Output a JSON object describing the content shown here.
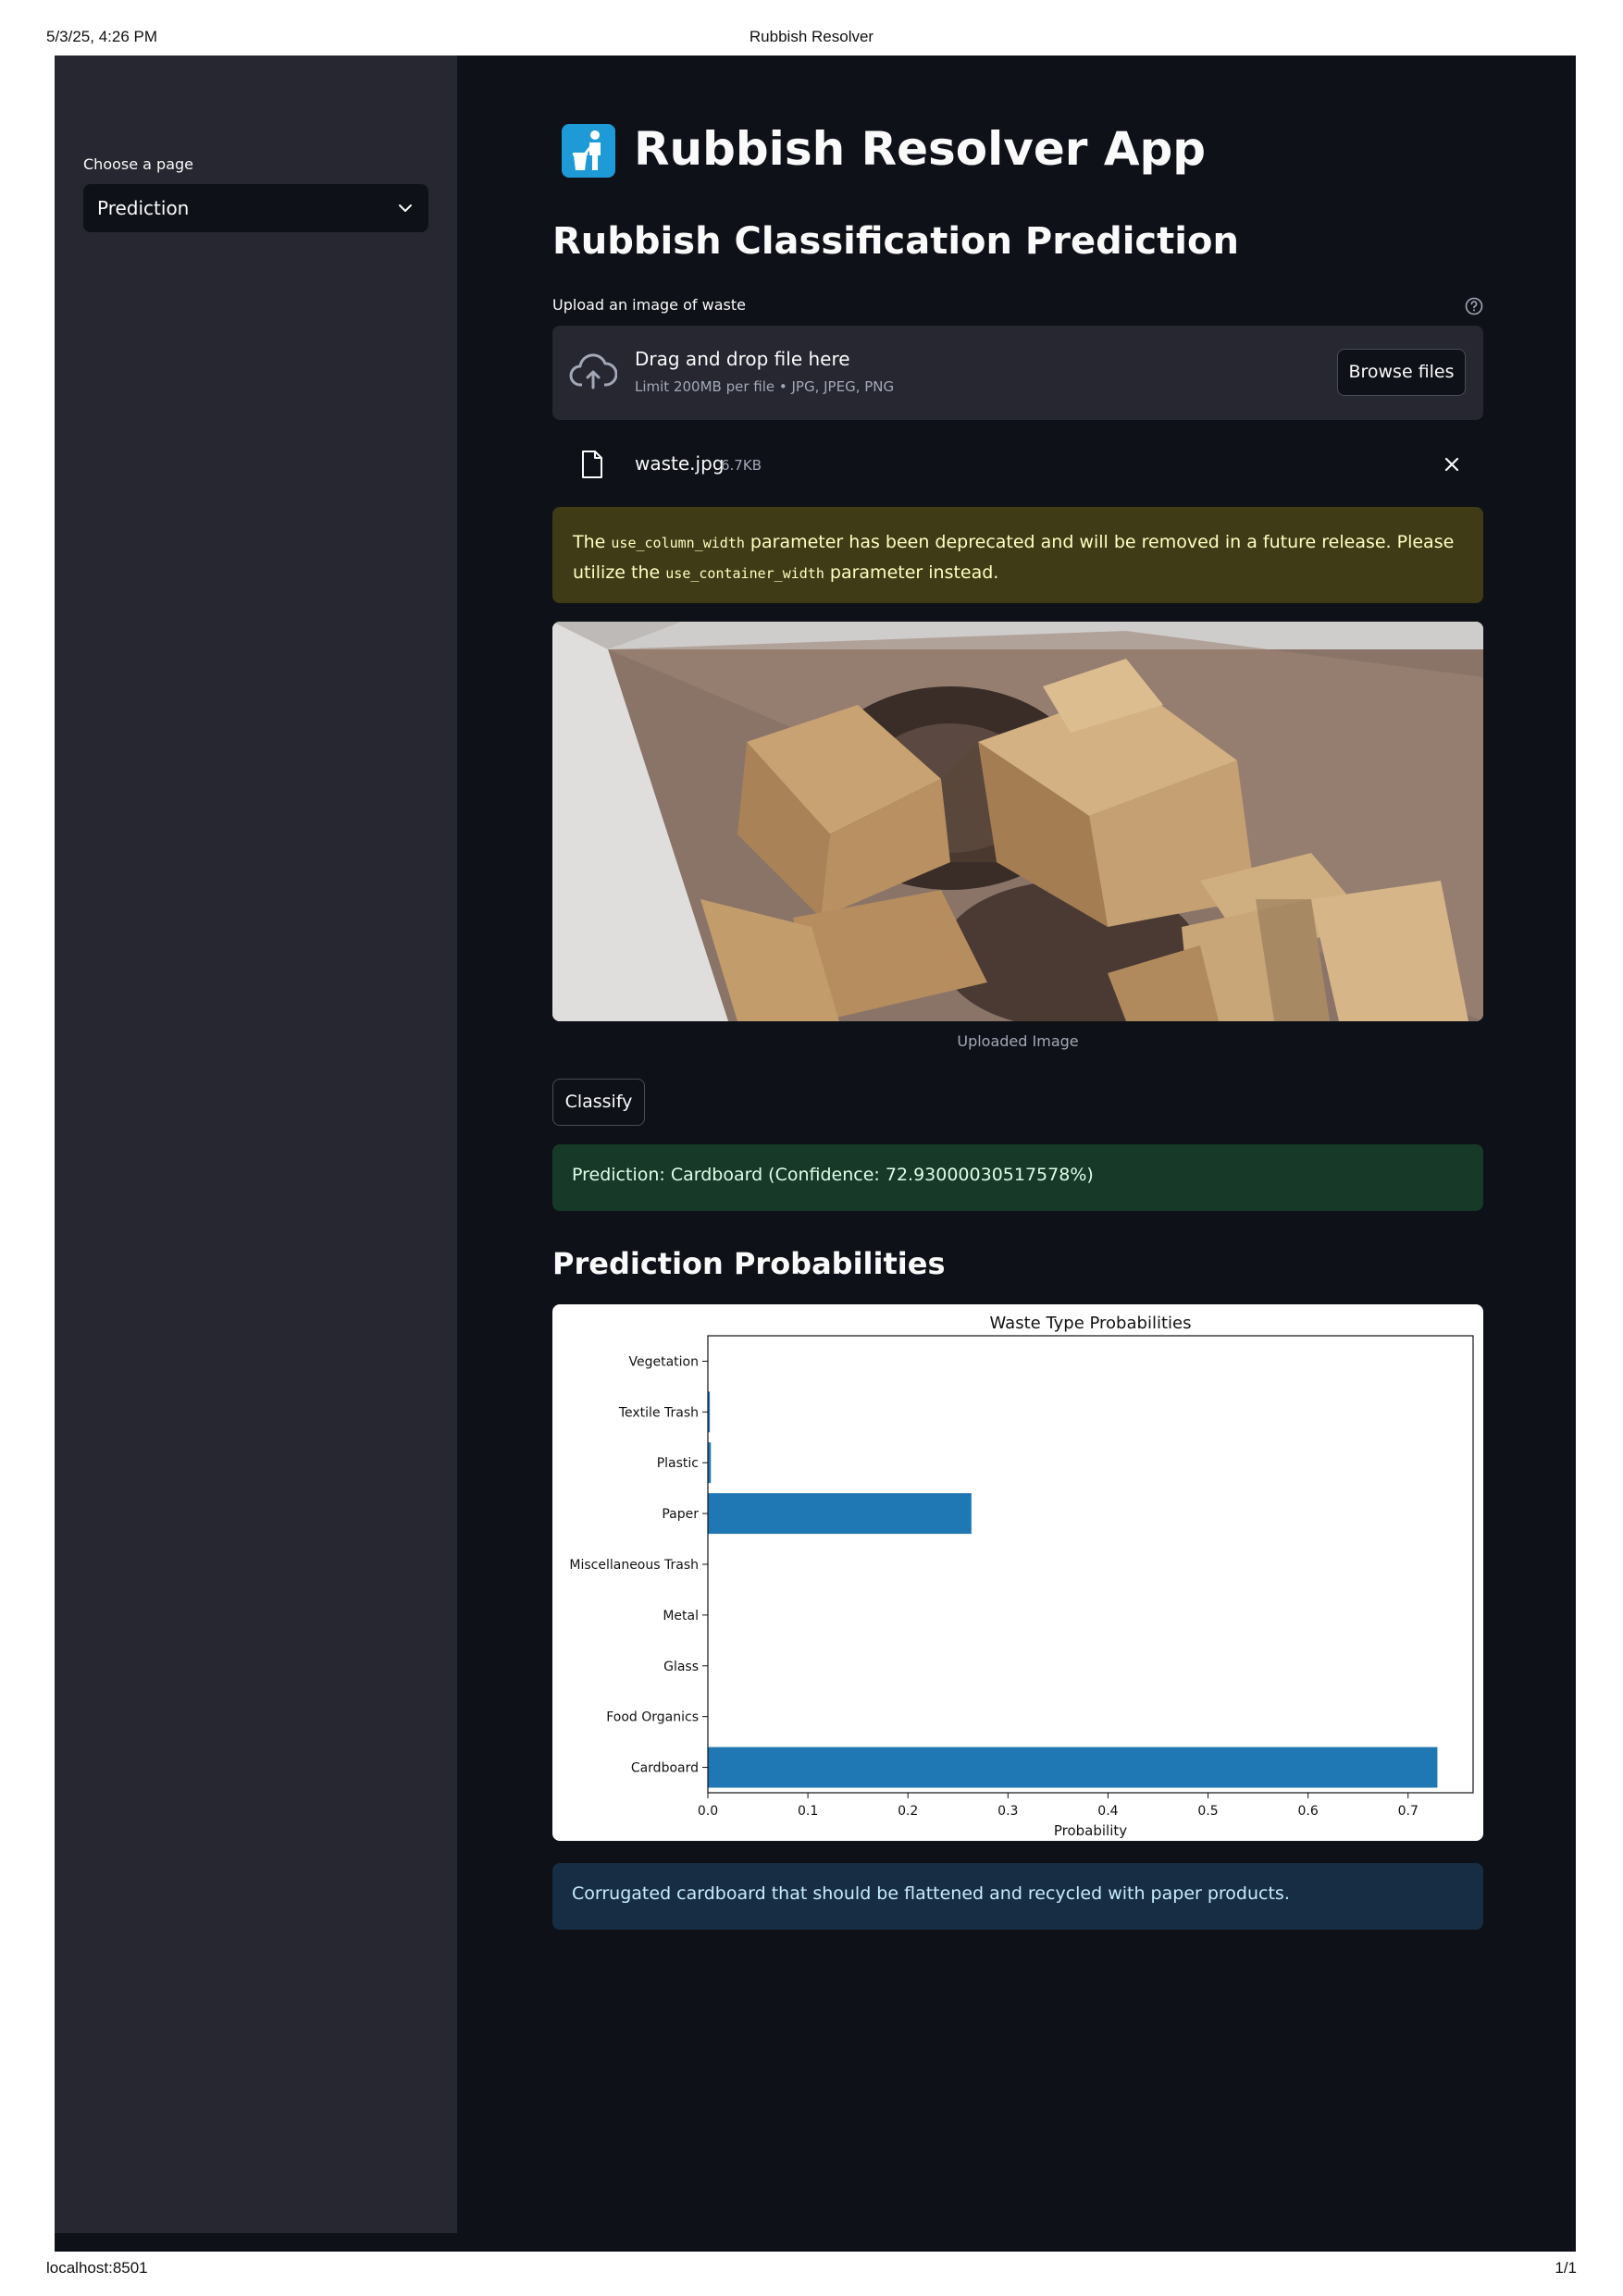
{
  "print": {
    "datetime": "5/3/25, 4:26 PM",
    "doc_title": "Rubbish Resolver",
    "url": "localhost:8501",
    "page": "1/1"
  },
  "sidebar": {
    "page_label": "Choose a page",
    "page_selected": "Prediction"
  },
  "main": {
    "app_title": "Rubbish Resolver App",
    "subtitle": "Rubbish Classification Prediction",
    "uploader": {
      "label": "Upload an image of waste",
      "drag_text": "Drag and drop file here",
      "limit_text": "Limit 200MB per file • JPG, JPEG, PNG",
      "browse_label": "Browse files",
      "file_name": "waste.jpg",
      "file_size": "6.7KB"
    },
    "warning": {
      "prefix": "The ",
      "code1": "use_column_width",
      "middle": " parameter has been deprecated and will be removed in a future release. Please utilize the ",
      "code2": "use_container_width",
      "suffix": " parameter instead."
    },
    "image_caption": "Uploaded Image",
    "classify_label": "Classify",
    "prediction_text": "Prediction: Cardboard (Confidence: 72.93000030517578%)",
    "probabilities_heading": "Prediction Probabilities",
    "info_text": "Corrugated cardboard that should be flattened and recycled with paper products."
  },
  "colors": {
    "app_bg": "#0e1117",
    "sidebar_bg": "#262730",
    "bar": "#1f77b4",
    "warning_bg": "#3e3b16",
    "success_bg": "#173928",
    "info_bg": "#172d43",
    "title_icon": "#1e9bd7"
  },
  "chart_data": {
    "type": "bar",
    "orientation": "horizontal",
    "title": "Waste Type Probabilities",
    "xlabel": "Probability",
    "ylabel": "",
    "categories": [
      "Cardboard",
      "Food Organics",
      "Glass",
      "Metal",
      "Miscellaneous Trash",
      "Paper",
      "Plastic",
      "Textile Trash",
      "Vegetation"
    ],
    "values": [
      0.7293,
      0.0,
      0.0,
      0.0,
      0.0,
      0.2635,
      0.003,
      0.002,
      0.0
    ],
    "xlim": [
      0,
      0.765
    ],
    "xticks": [
      0.0,
      0.1,
      0.2,
      0.3,
      0.4,
      0.5,
      0.6,
      0.7
    ],
    "xtick_labels": [
      "0.0",
      "0.1",
      "0.2",
      "0.3",
      "0.4",
      "0.5",
      "0.6",
      "0.7"
    ],
    "grid": false,
    "legend": "none"
  }
}
